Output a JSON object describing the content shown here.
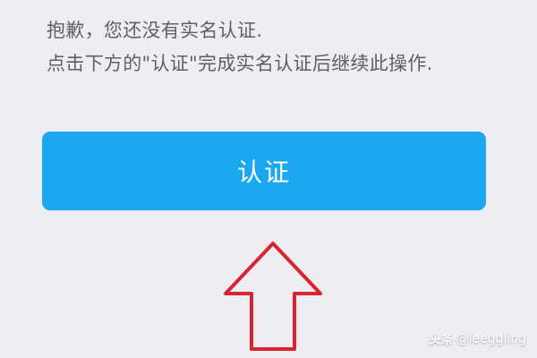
{
  "message": {
    "line1": "抱歉，您还没有实名认证.",
    "line2": "点击下方的\"认证\"完成实名认证后继续此操作."
  },
  "verify_button": {
    "label": "认证",
    "color": "#1ba8f0"
  },
  "annotation": {
    "icon": "up-arrow-icon",
    "color": "#d9232e"
  },
  "watermark": {
    "platform": "头条",
    "user": "@leeggling"
  }
}
